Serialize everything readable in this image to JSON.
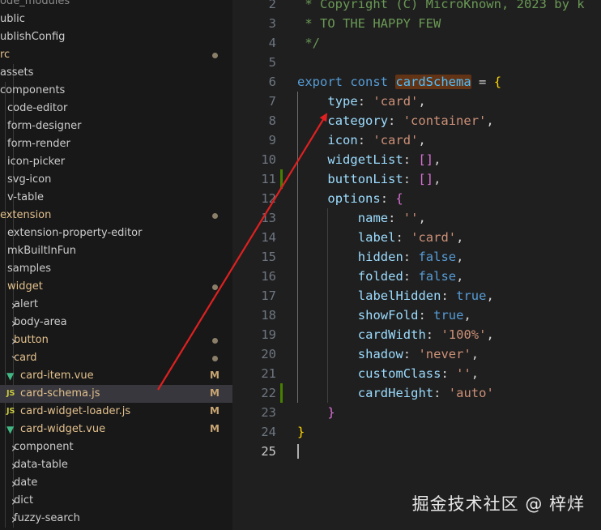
{
  "explorer": {
    "items": [
      {
        "label": "ode_modules",
        "depth": 0,
        "kind": "folder",
        "expanded": false,
        "chevron": false,
        "color": "#8b8b8b"
      },
      {
        "label": "ublic",
        "depth": 0,
        "kind": "folder",
        "expanded": false,
        "chevron": false
      },
      {
        "label": "ublishConfig",
        "depth": 0,
        "kind": "folder",
        "expanded": false,
        "chevron": false
      },
      {
        "label": "rc",
        "depth": 0,
        "kind": "folder",
        "expanded": true,
        "chevron": false,
        "color": "#e2c08d",
        "dot": true
      },
      {
        "label": "assets",
        "depth": 0,
        "kind": "folder",
        "expanded": false,
        "chevron": false
      },
      {
        "label": "components",
        "depth": 0,
        "kind": "folder",
        "expanded": true,
        "chevron": false
      },
      {
        "label": "code-editor",
        "depth": 1,
        "kind": "folder",
        "expanded": false,
        "chevron": false
      },
      {
        "label": "form-designer",
        "depth": 1,
        "kind": "folder",
        "expanded": false,
        "chevron": false
      },
      {
        "label": "form-render",
        "depth": 1,
        "kind": "folder",
        "expanded": false,
        "chevron": false
      },
      {
        "label": "icon-picker",
        "depth": 1,
        "kind": "folder",
        "expanded": false,
        "chevron": false
      },
      {
        "label": "svg-icon",
        "depth": 1,
        "kind": "folder",
        "expanded": false,
        "chevron": false
      },
      {
        "label": "v-table",
        "depth": 1,
        "kind": "folder",
        "expanded": false,
        "chevron": false
      },
      {
        "label": "extension",
        "depth": 0,
        "kind": "folder",
        "expanded": true,
        "chevron": false,
        "color": "#e2c08d",
        "dot": true
      },
      {
        "label": "extension-property-editor",
        "depth": 1,
        "kind": "folder",
        "expanded": false,
        "chevron": false
      },
      {
        "label": "mkBuiltInFun",
        "depth": 1,
        "kind": "folder",
        "expanded": false,
        "chevron": false
      },
      {
        "label": "samples",
        "depth": 1,
        "kind": "folder",
        "expanded": false,
        "chevron": false
      },
      {
        "label": "widget",
        "depth": 1,
        "kind": "folder",
        "expanded": true,
        "chevron": false,
        "color": "#e2c08d",
        "dot": true
      },
      {
        "label": "alert",
        "depth": 2,
        "kind": "folder",
        "expanded": false,
        "chevron": true
      },
      {
        "label": "body-area",
        "depth": 2,
        "kind": "folder",
        "expanded": false,
        "chevron": true
      },
      {
        "label": "button",
        "depth": 2,
        "kind": "folder",
        "expanded": false,
        "chevron": true,
        "color": "#e2c08d",
        "dot": true
      },
      {
        "label": "card",
        "depth": 2,
        "kind": "folder",
        "expanded": true,
        "chevron": true,
        "color": "#e2c08d",
        "dot": true
      },
      {
        "label": "card-item.vue",
        "depth": 3,
        "kind": "vue",
        "badge": "M",
        "color": "#e2c08d"
      },
      {
        "label": "card-schema.js",
        "depth": 3,
        "kind": "js",
        "badge": "M",
        "color": "#e2c08d",
        "selected": true
      },
      {
        "label": "card-widget-loader.js",
        "depth": 3,
        "kind": "js",
        "badge": "M",
        "color": "#e2c08d"
      },
      {
        "label": "card-widget.vue",
        "depth": 3,
        "kind": "vue",
        "badge": "M",
        "color": "#e2c08d"
      },
      {
        "label": "component",
        "depth": 2,
        "kind": "folder",
        "expanded": false,
        "chevron": true
      },
      {
        "label": "data-table",
        "depth": 2,
        "kind": "folder",
        "expanded": false,
        "chevron": true
      },
      {
        "label": "date",
        "depth": 2,
        "kind": "folder",
        "expanded": false,
        "chevron": true
      },
      {
        "label": "dict",
        "depth": 2,
        "kind": "folder",
        "expanded": false,
        "chevron": true
      },
      {
        "label": "fuzzy-search",
        "depth": 2,
        "kind": "folder",
        "expanded": false,
        "chevron": true
      }
    ]
  },
  "editor": {
    "active_line": 25,
    "modified_lines": [
      11,
      22
    ],
    "lines": [
      {
        "n": 2,
        "indent": 0,
        "tokens": [
          [
            " * Copyright (C) MicroKnown, 2023 by k",
            "cm"
          ]
        ]
      },
      {
        "n": 3,
        "indent": 0,
        "tokens": [
          [
            " * TO THE HAPPY FEW",
            "cm"
          ]
        ]
      },
      {
        "n": 4,
        "indent": 0,
        "tokens": [
          [
            " */",
            "cm"
          ]
        ]
      },
      {
        "n": 5,
        "indent": 0,
        "tokens": []
      },
      {
        "n": 6,
        "indent": 0,
        "tokens": [
          [
            "export",
            "kw"
          ],
          [
            " ",
            "pl"
          ],
          [
            "const",
            "kw"
          ],
          [
            " ",
            "pl"
          ],
          [
            "cardSchema",
            "var-hl"
          ],
          [
            " = ",
            "pl"
          ],
          [
            "{",
            "br1"
          ]
        ]
      },
      {
        "n": 7,
        "indent": 1,
        "tokens": [
          [
            "type",
            "prop"
          ],
          [
            ": ",
            "pl"
          ],
          [
            "'card'",
            "str"
          ],
          [
            ",",
            "pl"
          ]
        ]
      },
      {
        "n": 8,
        "indent": 1,
        "tokens": [
          [
            "category",
            "prop"
          ],
          [
            ": ",
            "pl"
          ],
          [
            "'container'",
            "str"
          ],
          [
            ",",
            "pl"
          ]
        ]
      },
      {
        "n": 9,
        "indent": 1,
        "tokens": [
          [
            "icon",
            "prop"
          ],
          [
            ": ",
            "pl"
          ],
          [
            "'card'",
            "str"
          ],
          [
            ",",
            "pl"
          ]
        ]
      },
      {
        "n": 10,
        "indent": 1,
        "tokens": [
          [
            "widgetList",
            "prop"
          ],
          [
            ": ",
            "pl"
          ],
          [
            "[]",
            "br2"
          ],
          [
            ",",
            "pl"
          ]
        ]
      },
      {
        "n": 11,
        "indent": 1,
        "tokens": [
          [
            "buttonList",
            "prop"
          ],
          [
            ": ",
            "pl"
          ],
          [
            "[]",
            "br2"
          ],
          [
            ",",
            "pl"
          ]
        ]
      },
      {
        "n": 12,
        "indent": 1,
        "tokens": [
          [
            "options",
            "prop"
          ],
          [
            ": ",
            "pl"
          ],
          [
            "{",
            "br2"
          ]
        ]
      },
      {
        "n": 13,
        "indent": 2,
        "tokens": [
          [
            "name",
            "prop"
          ],
          [
            ": ",
            "pl"
          ],
          [
            "''",
            "str"
          ],
          [
            ",",
            "pl"
          ]
        ]
      },
      {
        "n": 14,
        "indent": 2,
        "tokens": [
          [
            "label",
            "prop"
          ],
          [
            ": ",
            "pl"
          ],
          [
            "'card'",
            "str"
          ],
          [
            ",",
            "pl"
          ]
        ]
      },
      {
        "n": 15,
        "indent": 2,
        "tokens": [
          [
            "hidden",
            "prop"
          ],
          [
            ": ",
            "pl"
          ],
          [
            "false",
            "kw"
          ],
          [
            ",",
            "pl"
          ]
        ]
      },
      {
        "n": 16,
        "indent": 2,
        "tokens": [
          [
            "folded",
            "prop"
          ],
          [
            ": ",
            "pl"
          ],
          [
            "false",
            "kw"
          ],
          [
            ",",
            "pl"
          ]
        ]
      },
      {
        "n": 17,
        "indent": 2,
        "tokens": [
          [
            "labelHidden",
            "prop"
          ],
          [
            ": ",
            "pl"
          ],
          [
            "true",
            "kw"
          ],
          [
            ",",
            "pl"
          ]
        ]
      },
      {
        "n": 18,
        "indent": 2,
        "tokens": [
          [
            "showFold",
            "prop"
          ],
          [
            ": ",
            "pl"
          ],
          [
            "true",
            "kw"
          ],
          [
            ",",
            "pl"
          ]
        ]
      },
      {
        "n": 19,
        "indent": 2,
        "tokens": [
          [
            "cardWidth",
            "prop"
          ],
          [
            ": ",
            "pl"
          ],
          [
            "'100%'",
            "str"
          ],
          [
            ",",
            "pl"
          ]
        ]
      },
      {
        "n": 20,
        "indent": 2,
        "tokens": [
          [
            "shadow",
            "prop"
          ],
          [
            ": ",
            "pl"
          ],
          [
            "'never'",
            "str"
          ],
          [
            ",",
            "pl"
          ]
        ]
      },
      {
        "n": 21,
        "indent": 2,
        "tokens": [
          [
            "customClass",
            "prop"
          ],
          [
            ": ",
            "pl"
          ],
          [
            "''",
            "str"
          ],
          [
            ",",
            "pl"
          ]
        ]
      },
      {
        "n": 22,
        "indent": 2,
        "tokens": [
          [
            "cardHeight",
            "prop"
          ],
          [
            ": ",
            "pl"
          ],
          [
            "'auto'",
            "str"
          ]
        ]
      },
      {
        "n": 23,
        "indent": 1,
        "tokens": [
          [
            "}",
            "br2"
          ]
        ]
      },
      {
        "n": 24,
        "indent": 0,
        "tokens": [
          [
            "}",
            "br1"
          ]
        ]
      },
      {
        "n": 25,
        "indent": 0,
        "tokens": []
      }
    ]
  },
  "watermark": "掘金技术社区 @ 梓烊",
  "annotation": {
    "arrow_color": "#e02020",
    "icon": "red-arrow-icon"
  },
  "colors": {
    "sidebar_bg": "#181818",
    "editor_bg": "#1f1f1f",
    "selected_row": "#37373d",
    "modified": "#e2c08d",
    "vue_icon": "#41b883",
    "js_icon": "#cbcb41"
  }
}
